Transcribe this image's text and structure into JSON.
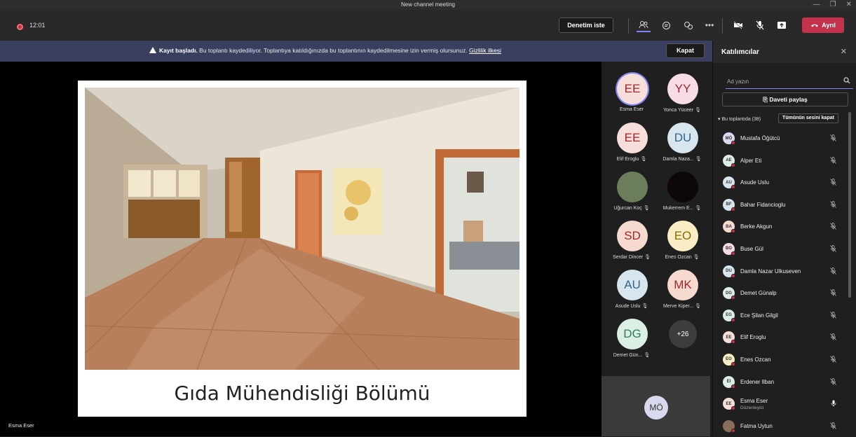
{
  "window": {
    "title": "New channel meeting"
  },
  "topbar": {
    "timer": "12:01",
    "denetim_label": "Denetim iste",
    "leave_label": "Ayrıl"
  },
  "banner": {
    "bold": "Kayıt başladı.",
    "text": " Bu toplantı kaydediliyor. Toplantıya katıldığınızda bu toplantının kaydedilmesine izin vermiş olursunuz. ",
    "link": "Gizlilik ilkesi",
    "close_label": "Kapat"
  },
  "stage": {
    "slide_title": "Gıda Mühendisliği Bölümü",
    "presenter_name": "Esma Eser"
  },
  "gallery": {
    "tiles": [
      {
        "initials": "EE",
        "name": "Esma Eser",
        "bg": "#f6dedb",
        "fg": "#a4262c",
        "mic": false
      },
      {
        "initials": "YY",
        "name": "Yonca Yüceer",
        "bg": "#f7dbe5",
        "fg": "#a4262c",
        "mic": true
      },
      {
        "initials": "EE",
        "name": "Elif Eroglu",
        "bg": "#f6dedb",
        "fg": "#a4262c",
        "mic": true
      },
      {
        "initials": "DU",
        "name": "Damla Naza...",
        "bg": "#d7e6ee",
        "fg": "#33658a",
        "mic": true
      },
      {
        "initials": "",
        "name": "Uğurcan Koç",
        "bg": "#6b7d5a",
        "fg": "#fff",
        "mic": true
      },
      {
        "initials": "",
        "name": "Mukerrem E...",
        "bg": "#0d0708",
        "fg": "#fff",
        "mic": true
      },
      {
        "initials": "SD",
        "name": "Serdar Dincer",
        "bg": "#f6d9cf",
        "fg": "#a4262c",
        "mic": true
      },
      {
        "initials": "EO",
        "name": "Enes Ozcan",
        "bg": "#f8edc4",
        "fg": "#8a6a00",
        "mic": true
      },
      {
        "initials": "AU",
        "name": "Asude Uslu",
        "bg": "#d7e6ee",
        "fg": "#33658a",
        "mic": true
      },
      {
        "initials": "MK",
        "name": "Merve Kiper...",
        "bg": "#f6d9cf",
        "fg": "#a4262c",
        "mic": true
      },
      {
        "initials": "DG",
        "name": "Demet Gün...",
        "bg": "#dcefe4",
        "fg": "#2e7d54",
        "mic": true
      },
      {
        "initials": "+26",
        "name": "",
        "bg": "#3d3d3d",
        "fg": "#ffffff",
        "mic": false
      }
    ],
    "self_initials": "MÖ"
  },
  "panel": {
    "title": "Katılımcılar",
    "search_placeholder": "Ad yazın",
    "invite_label": "Daveti paylaş",
    "section_label": "Bu toplantıda (38)",
    "mute_all_label": "Tümünün sesini kapat",
    "participants": [
      {
        "initials": "MÖ",
        "name": "Mustafa Öğütcü",
        "bg": "#d8d9ee"
      },
      {
        "initials": "AE",
        "name": "Alper Eti",
        "bg": "#dcefe4"
      },
      {
        "initials": "AU",
        "name": "Asude Uslu",
        "bg": "#d7e6ee"
      },
      {
        "initials": "BF",
        "name": "Bahar Fidancioglu",
        "bg": "#d7e6ee"
      },
      {
        "initials": "BA",
        "name": "Berke Akgun",
        "bg": "#f6d9cf"
      },
      {
        "initials": "BG",
        "name": "Buse Gül",
        "bg": "#f7dbe5"
      },
      {
        "initials": "DU",
        "name": "Damla Nazar Ulkuseven",
        "bg": "#d7e6ee"
      },
      {
        "initials": "DG",
        "name": "Demet Günalp",
        "bg": "#dcefe4"
      },
      {
        "initials": "EG",
        "name": "Ece Şilan Gilgil",
        "bg": "#dcefe4"
      },
      {
        "initials": "EE",
        "name": "Elif Eroglu",
        "bg": "#f6dedb"
      },
      {
        "initials": "EO",
        "name": "Enes Ozcan",
        "bg": "#f8edc4"
      },
      {
        "initials": "EI",
        "name": "Erdener Ilban",
        "bg": "#dcefe4"
      },
      {
        "initials": "EE",
        "name": "Esma Eser",
        "role": "Düzenleyici",
        "bg": "#f6dedb",
        "mic_on": true
      },
      {
        "initials": "",
        "name": "Fatma Uytun",
        "bg": "#8a6e5a",
        "photo": true
      }
    ]
  },
  "colors": {
    "accent": "#7f85f5",
    "leave": "#c4314b",
    "banner": "#3b3f5f"
  }
}
